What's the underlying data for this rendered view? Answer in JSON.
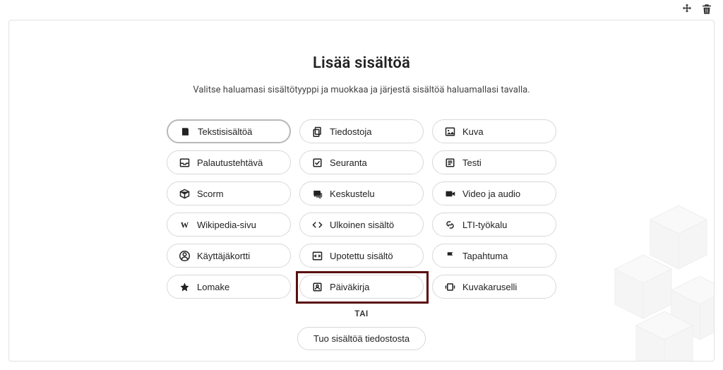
{
  "header": {
    "title": "Lisää sisältöä",
    "subtitle": "Valitse haluamasi sisältötyyppi ja muokkaa ja järjestä sisältöä haluamallasi tavalla."
  },
  "content_types": [
    {
      "id": "text",
      "label": "Tekstisisältöä",
      "icon": "book-icon",
      "selected": true
    },
    {
      "id": "files",
      "label": "Tiedostoja",
      "icon": "copy-icon",
      "selected": false
    },
    {
      "id": "image",
      "label": "Kuva",
      "icon": "image-icon",
      "selected": false
    },
    {
      "id": "assignment",
      "label": "Palautustehtävä",
      "icon": "inbox-icon",
      "selected": false
    },
    {
      "id": "tracking",
      "label": "Seuranta",
      "icon": "checkbox-icon",
      "selected": false
    },
    {
      "id": "test",
      "label": "Testi",
      "icon": "list-icon",
      "selected": false
    },
    {
      "id": "scorm",
      "label": "Scorm",
      "icon": "package-icon",
      "selected": false
    },
    {
      "id": "discussion",
      "label": "Keskustelu",
      "icon": "chat-icon",
      "selected": false
    },
    {
      "id": "video",
      "label": "Video ja audio",
      "icon": "video-icon",
      "selected": false
    },
    {
      "id": "wikipedia",
      "label": "Wikipedia-sivu",
      "icon": "wikipedia-icon",
      "selected": false
    },
    {
      "id": "external",
      "label": "Ulkoinen sisältö",
      "icon": "code-icon",
      "selected": false
    },
    {
      "id": "lti",
      "label": "LTI-työkalu",
      "icon": "link-icon",
      "selected": false
    },
    {
      "id": "usercard",
      "label": "Käyttäjäkortti",
      "icon": "user-icon",
      "selected": false
    },
    {
      "id": "embed",
      "label": "Upotettu sisältö",
      "icon": "embed-icon",
      "selected": false
    },
    {
      "id": "event",
      "label": "Tapahtuma",
      "icon": "flag-icon",
      "selected": false
    },
    {
      "id": "form",
      "label": "Lomake",
      "icon": "star-icon",
      "selected": false
    },
    {
      "id": "diary",
      "label": "Päiväkirja",
      "icon": "contact-icon",
      "selected": false,
      "highlighted": true
    },
    {
      "id": "carousel",
      "label": "Kuvakaruselli",
      "icon": "carousel-icon",
      "selected": false
    }
  ],
  "divider": {
    "label": "TAI"
  },
  "import": {
    "label": "Tuo sisältöä tiedostosta"
  },
  "toolbar": {
    "move": "move",
    "delete": "delete"
  }
}
